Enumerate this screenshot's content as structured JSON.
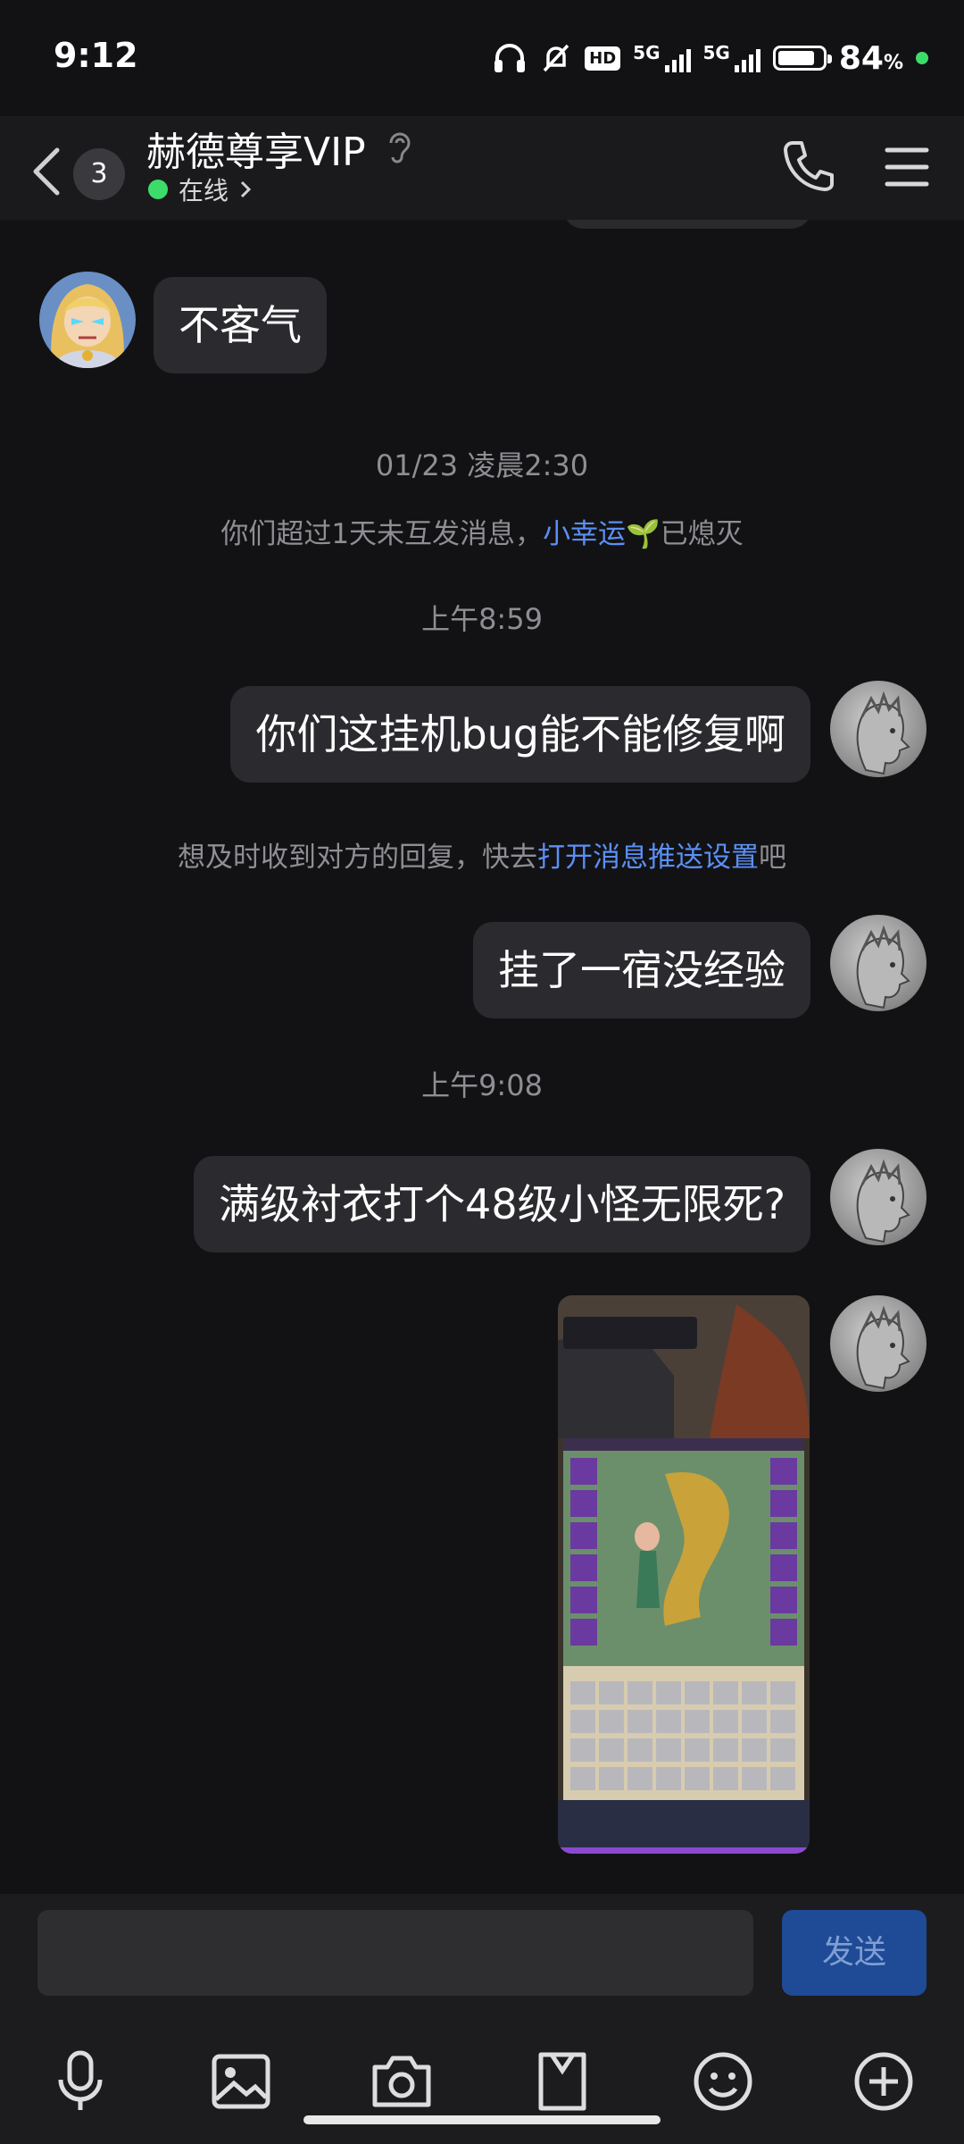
{
  "status_bar": {
    "time": "9:12",
    "hd_label": "HD",
    "net1": "5G",
    "net2": "5G",
    "battery_pct": "84",
    "battery_unit": "%",
    "battery_level": 0.84
  },
  "header": {
    "back_count": "3",
    "title": "赫德尊享VIP",
    "status": "在线"
  },
  "messages": [
    {
      "side": "left",
      "text": "不客气"
    },
    {
      "type": "timestamp",
      "text": "01/23 凌晨2:30"
    },
    {
      "type": "system",
      "pre": "你们超过1天未互发消息，",
      "link": "小幸运",
      "emoji": "🌱",
      "post": "已熄灭"
    },
    {
      "type": "timestamp",
      "text": "上午8:59"
    },
    {
      "side": "right",
      "text": "你们这挂机bug能不能修复啊"
    },
    {
      "type": "system",
      "pre": "想及时收到对方的回复，快去",
      "link": "打开消息推送设置",
      "post": "吧"
    },
    {
      "side": "right",
      "text": "挂了一宿没经验"
    },
    {
      "type": "timestamp",
      "text": "上午9:08"
    },
    {
      "side": "right",
      "text": "满级衬衣打个48级小怪无限死?"
    },
    {
      "side": "right",
      "type": "image"
    }
  ],
  "composer": {
    "send_label": "发送",
    "input_value": ""
  },
  "toolbar_icons": [
    "microphone-icon",
    "image-icon",
    "camera-icon",
    "file-icon",
    "emoji-icon",
    "plus-icon"
  ],
  "colors": {
    "bubble": "#2b2b2f",
    "link": "#5b8ff5",
    "send": "#1f4a96",
    "online": "#3ddc6a"
  }
}
